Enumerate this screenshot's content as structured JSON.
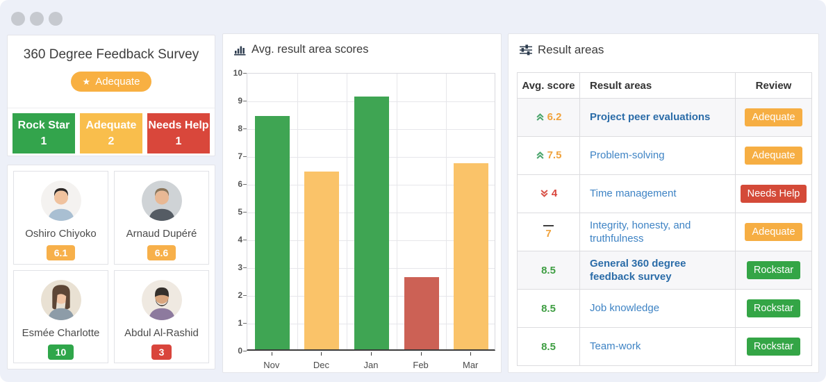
{
  "window": {
    "dot_count": 3
  },
  "survey": {
    "title": "360 Degree Feedback Survey",
    "badge": {
      "label": "Adequate",
      "icon": "star-icon",
      "color": "#f8b042"
    },
    "stats": [
      {
        "label": "Rock Star",
        "count": "1",
        "color": "#33a44c"
      },
      {
        "label": "Adequate",
        "count": "2",
        "color": "#f9be4c"
      },
      {
        "label": "Needs Help",
        "count": "1",
        "color": "#d9473b"
      }
    ],
    "members": [
      {
        "name": "Oshiro Chiyoko",
        "score": "6.1",
        "score_color": "#f7b04a",
        "avatar": {
          "bg": "#f4f2f0",
          "hair": "#2b2624",
          "skin": "#f0c29e",
          "shirt": "#a9bfd2",
          "hair_style": "short"
        }
      },
      {
        "name": "Arnaud Dupéré",
        "score": "6.6",
        "score_color": "#f7b04a",
        "avatar": {
          "bg": "#cfd3d6",
          "hair": "#8a7458",
          "skin": "#e8b894",
          "shirt": "#555c64",
          "hair_style": "short"
        }
      },
      {
        "name": "Esmée Charlotte",
        "score": "10",
        "score_color": "#2fa64a",
        "avatar": {
          "bg": "#e9e1d3",
          "hair": "#5d4636",
          "skin": "#f0c4a4",
          "shirt": "#8d9ca8",
          "hair_style": "long"
        }
      },
      {
        "name": "Abdul Al-Rashid",
        "score": "3",
        "score_color": "#d9453c",
        "avatar": {
          "bg": "#efe9e1",
          "hair": "#35302c",
          "skin": "#d9a67f",
          "shirt": "#8d7a9e",
          "hair_style": "beard"
        }
      }
    ]
  },
  "chart": {
    "title": "Avg. result area scores",
    "icon": "bar-chart-icon"
  },
  "chart_data": {
    "type": "bar",
    "title": "Avg. result area scores",
    "categories": [
      "Nov",
      "Dec",
      "Jan",
      "Feb",
      "Mar"
    ],
    "values": [
      8.4,
      6.4,
      9.1,
      2.6,
      6.7
    ],
    "colors": [
      "#3fa553",
      "#fac369",
      "#3fa553",
      "#cc6155",
      "#fac369"
    ],
    "xlabel": "",
    "ylabel": "",
    "ylim": [
      0,
      10
    ],
    "ytick_step": 1,
    "grid": true,
    "legend": false
  },
  "result_areas": {
    "title": "Result areas",
    "icon": "sliders-icon",
    "headers": [
      "Avg. score",
      "Result areas",
      "Review"
    ],
    "trend_colors": {
      "up": "#4aa56c",
      "down": "#d9544a"
    },
    "rows": [
      {
        "score": "6.2",
        "trend": "up",
        "score_color": "#f0a23c",
        "area": "Project peer evaluations",
        "bold": true,
        "highlight": true,
        "review": "Adequate",
        "review_color": "#f6ae43"
      },
      {
        "score": "7.5",
        "trend": "up",
        "score_color": "#f0a23c",
        "area": "Problem-solving",
        "bold": false,
        "highlight": false,
        "review": "Adequate",
        "review_color": "#f6ae43"
      },
      {
        "score": "4",
        "trend": "down",
        "score_color": "#d9453c",
        "area": "Time management",
        "bold": false,
        "highlight": false,
        "review": "Needs Help",
        "review_color": "#d44a38"
      },
      {
        "score": "7",
        "trend": "flat",
        "score_color": "#f0a23c",
        "area": "Integrity, honesty, and truthfulness",
        "bold": false,
        "highlight": false,
        "review": "Adequate",
        "review_color": "#f6ae43"
      },
      {
        "score": "8.5",
        "trend": "none",
        "score_color": "#3f9e43",
        "area": "General 360 degree feedback survey",
        "bold": true,
        "highlight": true,
        "review": "Rockstar",
        "review_color": "#34a546"
      },
      {
        "score": "8.5",
        "trend": "none",
        "score_color": "#3f9e43",
        "area": "Job knowledge",
        "bold": false,
        "highlight": false,
        "review": "Rockstar",
        "review_color": "#34a546"
      },
      {
        "score": "8.5",
        "trend": "none",
        "score_color": "#3f9e43",
        "area": "Team-work",
        "bold": false,
        "highlight": false,
        "review": "Rockstar",
        "review_color": "#34a546"
      }
    ],
    "link_color": "#3e83c4",
    "link_bold_color": "#2b6ca8"
  }
}
